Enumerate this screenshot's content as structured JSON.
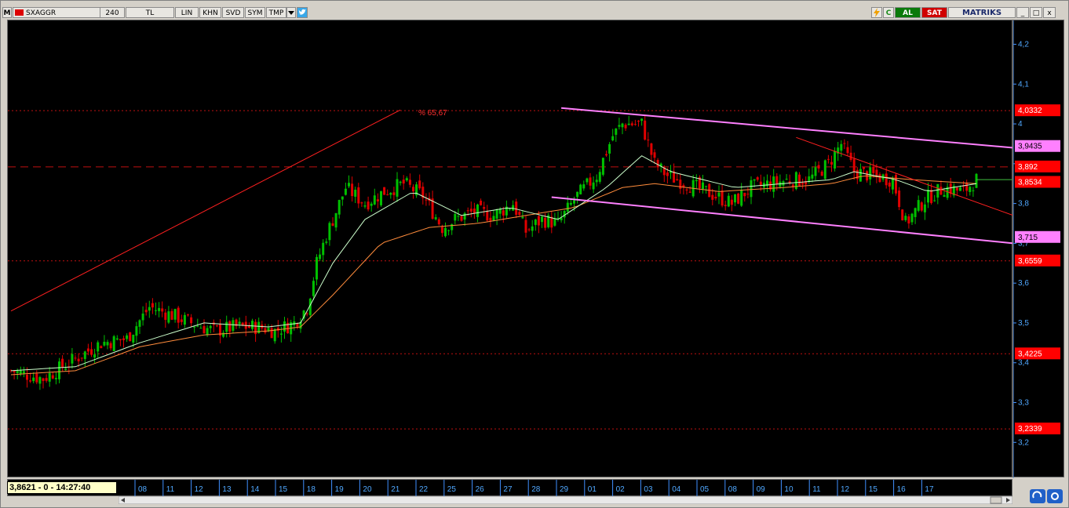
{
  "toolbar": {
    "logo": "M",
    "symbol": "SXAGGR",
    "period": "240",
    "currency": "TL",
    "buttons": [
      "LIN",
      "KHN",
      "SVD",
      "SYM",
      "TMP"
    ],
    "right": {
      "c_label": "C",
      "buy_label": "AL",
      "sell_label": "SAT",
      "brand": "MATRIKS",
      "win_min": "_",
      "win_max": "□",
      "win_close": "x"
    },
    "icons": [
      "chart-logo-icon",
      "flag-icon",
      "dropdown-arrow-icon",
      "twitter-bird-icon",
      "lightning-icon",
      "c-icon",
      "minimize-icon",
      "maximize-icon",
      "close-icon"
    ]
  },
  "readout": "3,8621 - 0 - 14:27:40",
  "annotation": "% 65,67",
  "colors": {
    "background": "#000000",
    "up": "#00c000",
    "down": "#e00000",
    "ma_short": "#ccffcc",
    "ma_long": "#ff8c3c",
    "channel": "#ff80ff",
    "trend": "#ff2020",
    "level_label_bg": "#ff0000",
    "channel_label_bg": "#ff80ff"
  },
  "chart_data": {
    "type": "candlestick",
    "ylim": [
      3.11,
      4.26
    ],
    "y_ticks": [
      "3,2",
      "3,3",
      "3,4",
      "3,5",
      "3,6",
      "3,7",
      "3,8",
      "3,9",
      "4",
      "4,1",
      "4,2"
    ],
    "y_tick_values": [
      3.2,
      3.3,
      3.4,
      3.5,
      3.6,
      3.7,
      3.8,
      3.9,
      4.0,
      4.1,
      4.2
    ],
    "x_labels": [
      "08",
      "11",
      "12",
      "13",
      "14",
      "15",
      "18",
      "19",
      "20",
      "21",
      "22",
      "25",
      "26",
      "27",
      "28",
      "29",
      "01",
      "02",
      "03",
      "04",
      "05",
      "08",
      "09",
      "10",
      "11",
      "12",
      "15",
      "16",
      "17"
    ],
    "horizontal_levels": [
      {
        "label": "4,0332",
        "value": 4.0332,
        "style": "dotted"
      },
      {
        "label": "3,892",
        "value": 3.892,
        "style": "dashed"
      },
      {
        "label": "3,6559",
        "value": 3.6559,
        "style": "dotted"
      },
      {
        "label": "3,4225",
        "value": 3.4225,
        "style": "dotted"
      },
      {
        "label": "3,2339",
        "value": 3.2339,
        "style": "dotted"
      }
    ],
    "right_labels": [
      {
        "label": "4,0332",
        "value": 4.0332,
        "kind": "level"
      },
      {
        "label": "3,9435",
        "value": 3.9435,
        "kind": "channel"
      },
      {
        "label": "3,892",
        "value": 3.892,
        "kind": "level"
      },
      {
        "label": "3,8534",
        "value": 3.8534,
        "kind": "level"
      },
      {
        "label": "3,715",
        "value": 3.715,
        "kind": "channel"
      },
      {
        "label": "3,6559",
        "value": 3.6559,
        "kind": "level"
      },
      {
        "label": "3,4225",
        "value": 3.4225,
        "kind": "level"
      },
      {
        "label": "3,2339",
        "value": 3.2339,
        "kind": "level"
      }
    ],
    "close_path": [
      [
        0,
        3.38
      ],
      [
        10,
        3.36
      ],
      [
        18,
        3.4
      ],
      [
        28,
        3.45
      ],
      [
        36,
        3.46
      ],
      [
        43,
        3.54
      ],
      [
        50,
        3.52
      ],
      [
        56,
        3.5
      ],
      [
        63,
        3.48
      ],
      [
        70,
        3.49
      ],
      [
        77,
        3.49
      ],
      [
        82,
        3.48
      ],
      [
        88,
        3.5
      ],
      [
        92,
        3.54
      ],
      [
        95,
        3.65
      ],
      [
        98,
        3.72
      ],
      [
        104,
        3.84
      ],
      [
        110,
        3.8
      ],
      [
        116,
        3.83
      ],
      [
        122,
        3.85
      ],
      [
        128,
        3.82
      ],
      [
        134,
        3.74
      ],
      [
        138,
        3.76
      ],
      [
        144,
        3.78
      ],
      [
        150,
        3.77
      ],
      [
        156,
        3.8
      ],
      [
        160,
        3.73
      ],
      [
        165,
        3.76
      ],
      [
        170,
        3.75
      ],
      [
        176,
        3.82
      ],
      [
        182,
        3.87
      ],
      [
        187,
        3.97
      ],
      [
        190,
        4.0
      ],
      [
        196,
        4.0
      ],
      [
        200,
        3.9
      ],
      [
        204,
        3.87
      ],
      [
        210,
        3.85
      ],
      [
        216,
        3.83
      ],
      [
        224,
        3.8
      ],
      [
        230,
        3.84
      ],
      [
        236,
        3.85
      ],
      [
        242,
        3.86
      ],
      [
        248,
        3.86
      ],
      [
        254,
        3.9
      ],
      [
        258,
        3.95
      ],
      [
        262,
        3.88
      ],
      [
        268,
        3.87
      ],
      [
        274,
        3.86
      ],
      [
        278,
        3.75
      ],
      [
        284,
        3.81
      ],
      [
        290,
        3.84
      ],
      [
        296,
        3.83
      ],
      [
        300,
        3.86
      ]
    ],
    "ma_short_path": [
      [
        0,
        3.38
      ],
      [
        20,
        3.39
      ],
      [
        40,
        3.45
      ],
      [
        60,
        3.5
      ],
      [
        80,
        3.49
      ],
      [
        90,
        3.5
      ],
      [
        100,
        3.65
      ],
      [
        110,
        3.76
      ],
      [
        125,
        3.83
      ],
      [
        140,
        3.77
      ],
      [
        155,
        3.79
      ],
      [
        170,
        3.76
      ],
      [
        185,
        3.84
      ],
      [
        196,
        3.92
      ],
      [
        205,
        3.88
      ],
      [
        215,
        3.86
      ],
      [
        225,
        3.84
      ],
      [
        240,
        3.85
      ],
      [
        255,
        3.86
      ],
      [
        262,
        3.88
      ],
      [
        275,
        3.86
      ],
      [
        285,
        3.83
      ],
      [
        300,
        3.85
      ]
    ],
    "ma_long_path": [
      [
        0,
        3.37
      ],
      [
        20,
        3.38
      ],
      [
        40,
        3.44
      ],
      [
        60,
        3.47
      ],
      [
        80,
        3.48
      ],
      [
        90,
        3.49
      ],
      [
        100,
        3.57
      ],
      [
        115,
        3.7
      ],
      [
        130,
        3.74
      ],
      [
        145,
        3.75
      ],
      [
        160,
        3.77
      ],
      [
        175,
        3.79
      ],
      [
        190,
        3.84
      ],
      [
        200,
        3.85
      ],
      [
        220,
        3.83
      ],
      [
        240,
        3.84
      ],
      [
        255,
        3.85
      ],
      [
        265,
        3.87
      ],
      [
        280,
        3.86
      ],
      [
        300,
        3.85
      ]
    ],
    "trend_lines": [
      {
        "from": [
          0,
          3.53
        ],
        "to": [
          121,
          4.035
        ],
        "color": "trend"
      },
      {
        "from": [
          244,
          3.966
        ],
        "to": [
          300,
          3.77
        ],
        "color": "trend"
      }
    ],
    "channel_lines": [
      {
        "from": [
          171,
          4.04
        ],
        "to": [
          300,
          3.94
        ]
      },
      {
        "from": [
          168,
          3.816
        ],
        "to": [
          300,
          3.7
        ]
      }
    ]
  }
}
